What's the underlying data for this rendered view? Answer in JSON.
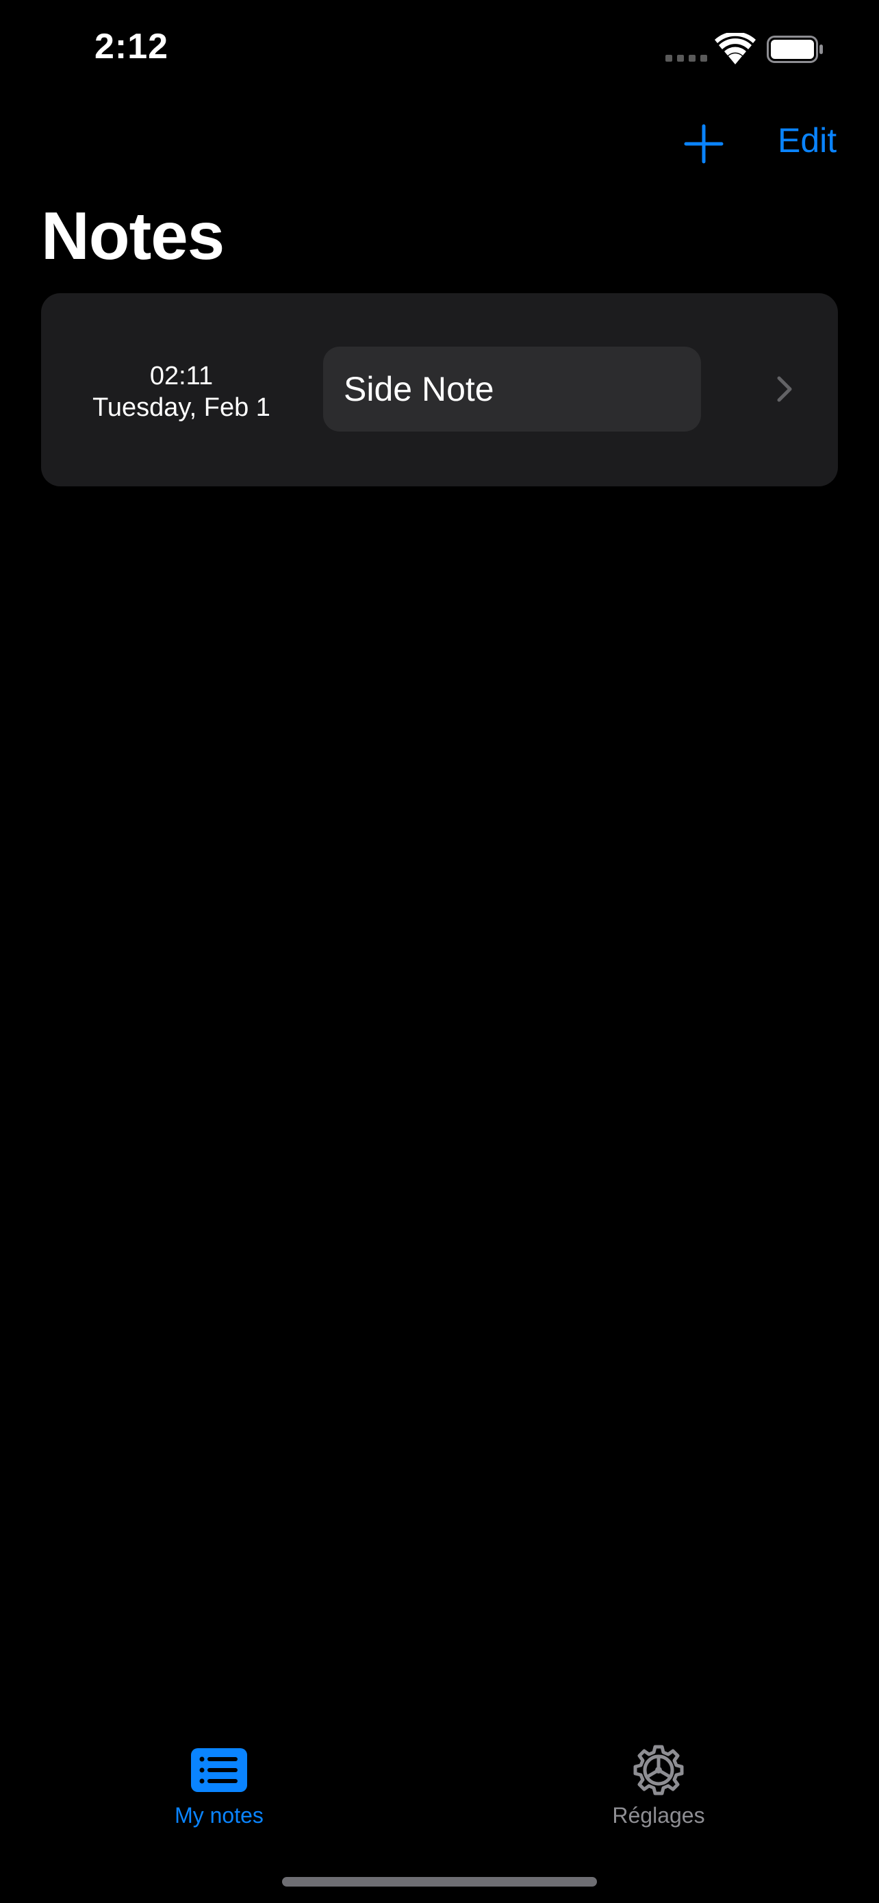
{
  "status_bar": {
    "time": "2:12"
  },
  "nav": {
    "add_icon": "plus-icon",
    "edit_label": "Edit"
  },
  "page": {
    "title": "Notes"
  },
  "notes": [
    {
      "time": "02:11",
      "date": "Tuesday, Feb 1",
      "title": "Side Note"
    }
  ],
  "tab_bar": {
    "tabs": [
      {
        "label": "My notes",
        "icon": "list-icon",
        "selected": true
      },
      {
        "label": "Réglages",
        "icon": "gear-icon",
        "selected": false
      }
    ]
  },
  "colors": {
    "accent": "#0a84ff",
    "background": "#000000",
    "card": "#1c1c1e",
    "field": "#2c2c2e",
    "inactive": "#8e8e93"
  }
}
